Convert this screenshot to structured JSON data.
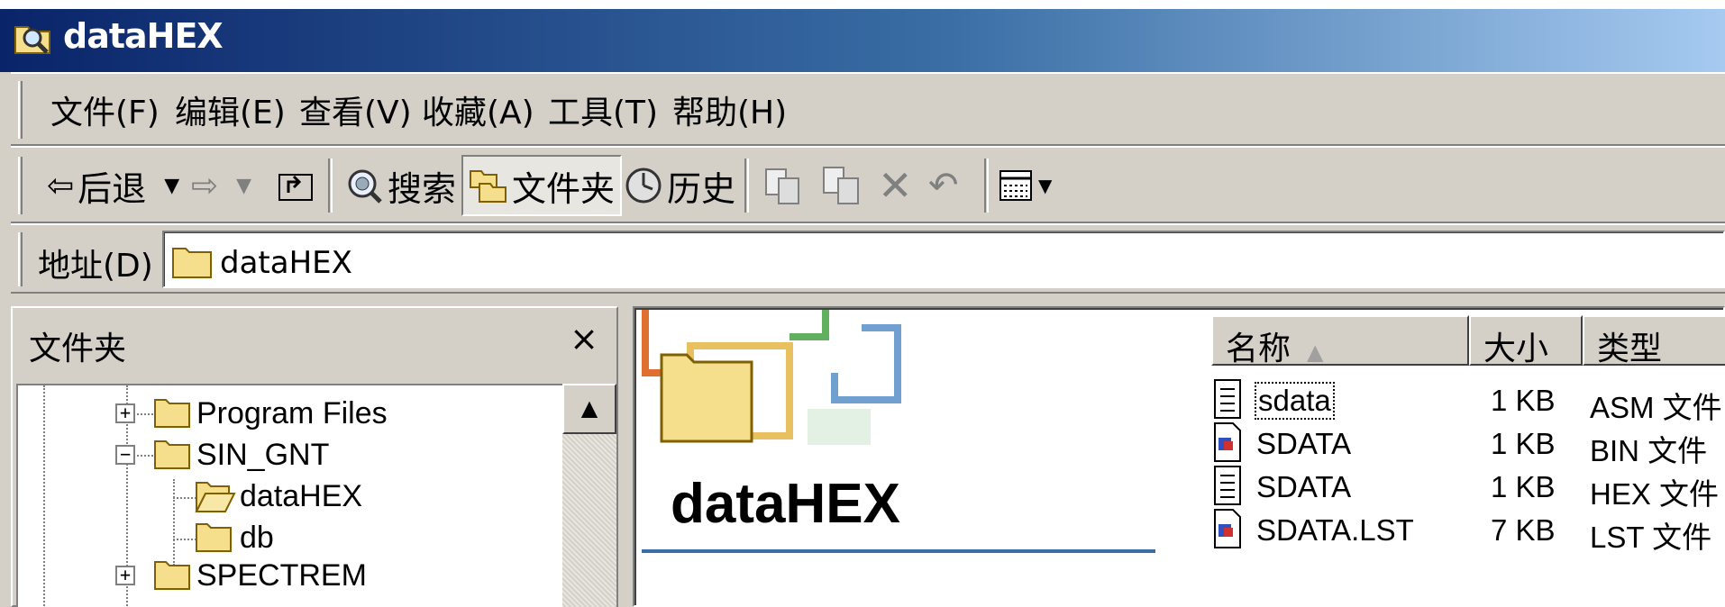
{
  "window": {
    "title": "dataHEX",
    "icon": "search-folder-icon"
  },
  "menu": [
    "文件(F)",
    "编辑(E)",
    "查看(V)",
    "收藏(A)",
    "工具(T)",
    "帮助(H)"
  ],
  "toolbar": {
    "back": "后退",
    "search": "搜索",
    "folders": "文件夹",
    "history": "历史"
  },
  "address": {
    "label": "地址(D)",
    "value": "dataHEX"
  },
  "folder_pane": {
    "title": "文件夹",
    "close": "×",
    "tree": [
      {
        "label": "Program Files",
        "expander": "+"
      },
      {
        "label": "SIN_GNT",
        "expander": "−"
      },
      {
        "label": "dataHEX"
      },
      {
        "label": "db"
      },
      {
        "label": "SPECTREM",
        "expander": "+"
      }
    ]
  },
  "content": {
    "folder_title": "dataHEX",
    "columns": {
      "name": "名称",
      "size": "大小",
      "type": "类型"
    },
    "sort_arrow": "▲",
    "files": [
      {
        "name": "sdata",
        "size": "1 KB",
        "type": "ASM 文件",
        "icon": "text-file-icon"
      },
      {
        "name": "SDATA",
        "size": "1 KB",
        "type": "BIN 文件",
        "icon": "binary-file-icon"
      },
      {
        "name": "SDATA",
        "size": "1 KB",
        "type": "HEX 文件",
        "icon": "text-file-icon"
      },
      {
        "name": "SDATA.LST",
        "size": "7 KB",
        "type": "LST 文件",
        "icon": "binary-file-icon"
      }
    ]
  },
  "colors": {
    "titlebar_start": "#0a246a",
    "titlebar_end": "#a6caf0",
    "face": "#d4d0c8",
    "folder": "#f5de8c"
  }
}
